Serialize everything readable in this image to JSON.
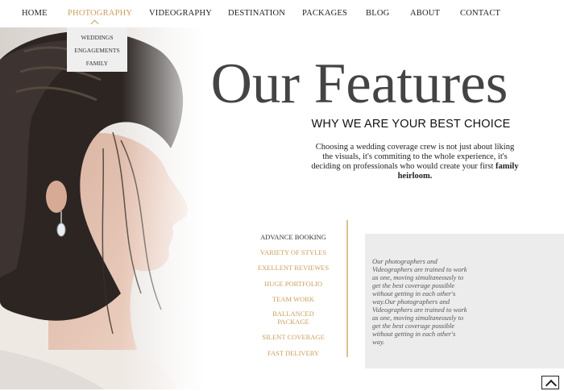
{
  "nav": {
    "items": [
      {
        "label": "HOME"
      },
      {
        "label": "PHOTOGRAPHY"
      },
      {
        "label": "VIDEOGRAPHY"
      },
      {
        "label": "DESTINATION"
      },
      {
        "label": "PACKAGES"
      },
      {
        "label": "BLOG"
      },
      {
        "label": "ABOUT"
      },
      {
        "label": "CONTACT"
      }
    ],
    "active_item": "PHOTOGRAPHY",
    "dropdown": [
      {
        "label": "WEDDINGS"
      },
      {
        "label": "ENGAGEMENTS"
      },
      {
        "label": "FAMILY"
      }
    ]
  },
  "hero": {
    "title": "Our Features",
    "subtitle": "WHY WE ARE YOUR BEST CHOICE",
    "intro_text": "Choosing a wedding coverage crew is not just about liking the visuals, it's commiting to the whole experience, it's deciding on professionals who would create your first ",
    "intro_bold": "family heirloom."
  },
  "features": {
    "items": [
      {
        "label": "ADVANCE BOOKING"
      },
      {
        "label": "VARIETY OF STYLES"
      },
      {
        "label": "EXELLENT REVIEWES"
      },
      {
        "label": "HUGE PORTFOLIO"
      },
      {
        "label": "TEAM WORK"
      },
      {
        "label": "BALLANCED PACKAGE"
      },
      {
        "label": "SILENT COVERAGE"
      },
      {
        "label": "FAST DELIVERY"
      }
    ],
    "active_item": "ADVANCE BOOKING",
    "panel_text": "Our photographers and Videographers are trained to work as one, moving simultaneously to get the best coverage possible without getting in each other's way.Our photographers and Videographers are trained to work as one, moving simultaneously to get the best coverage possible without getting in each other's way."
  },
  "colors": {
    "accent": "#c9a05c",
    "panel_bg": "#ececec",
    "title": "#444444"
  },
  "icons": {
    "back_to_top": "chevron-up-icon",
    "dropdown_caret": "caret-up-icon",
    "hero_photo": "bride-profile-photo"
  }
}
